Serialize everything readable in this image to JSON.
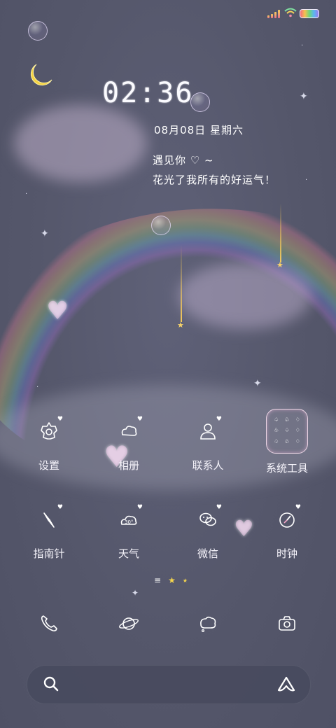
{
  "status_bar": {
    "signal_bars": 4,
    "wifi": "wifi-icon",
    "battery": "battery-icon"
  },
  "clock": {
    "time": "02:36",
    "date": "08月08日 星期六"
  },
  "quote": {
    "line1": "遇见你 ♡ ~",
    "line2": "花光了我所有的好运气！"
  },
  "apps_row1": [
    {
      "label": "设置",
      "icon": "gear-icon"
    },
    {
      "label": "相册",
      "icon": "gallery-icon"
    },
    {
      "label": "联系人",
      "icon": "person-icon"
    },
    {
      "label": "系统工具",
      "icon": "folder-icon"
    }
  ],
  "apps_row2": [
    {
      "label": "指南针",
      "icon": "compass-needle-icon"
    },
    {
      "label": "天气",
      "icon": "weather-icon",
      "badge": "30°"
    },
    {
      "label": "微信",
      "icon": "wechat-icon"
    },
    {
      "label": "时钟",
      "icon": "clock-icon"
    }
  ],
  "dock": [
    {
      "icon": "phone-icon"
    },
    {
      "icon": "planet-icon"
    },
    {
      "icon": "message-bubble-icon"
    },
    {
      "icon": "camera-icon"
    }
  ],
  "page_indicator": {
    "pages": 3,
    "current": 2
  },
  "search": {
    "icon": "search-icon",
    "assistant_icon": "assistant-icon"
  }
}
